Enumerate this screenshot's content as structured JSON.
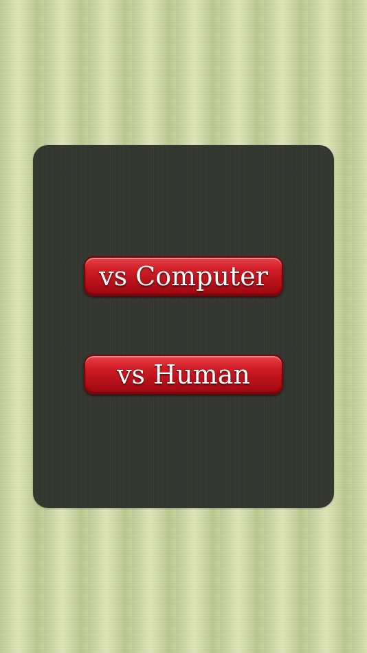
{
  "menu": {
    "buttons": [
      {
        "id": "vs-computer",
        "label": "vs Computer"
      },
      {
        "id": "vs-human",
        "label": "vs Human"
      }
    ]
  },
  "colors": {
    "background": "#cdd8a3",
    "panel": "#33352f",
    "button": "#d21f28",
    "button_text": "#ffffff"
  }
}
